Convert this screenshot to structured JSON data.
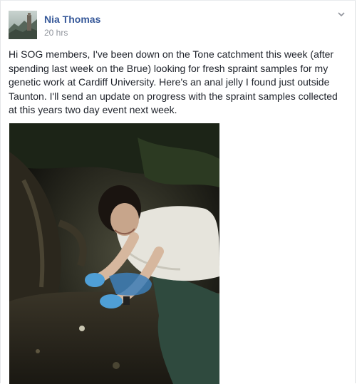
{
  "post": {
    "author": "Nia Thomas",
    "timestamp": "20 hrs",
    "text": "Hi SOG members, I've been down on the Tone catchment this week (after spending last week on the Brue) looking for fresh spraint samples for my genetic work at Cardiff University. Here's an anal jelly I found just outside Taunton. I'll send an update on progress with the spraint samples collected at this years two day event next week.",
    "menu_icon": "chevron-down-icon"
  },
  "colors": {
    "link": "#365899",
    "meta": "#90949c",
    "text": "#1d2129"
  }
}
